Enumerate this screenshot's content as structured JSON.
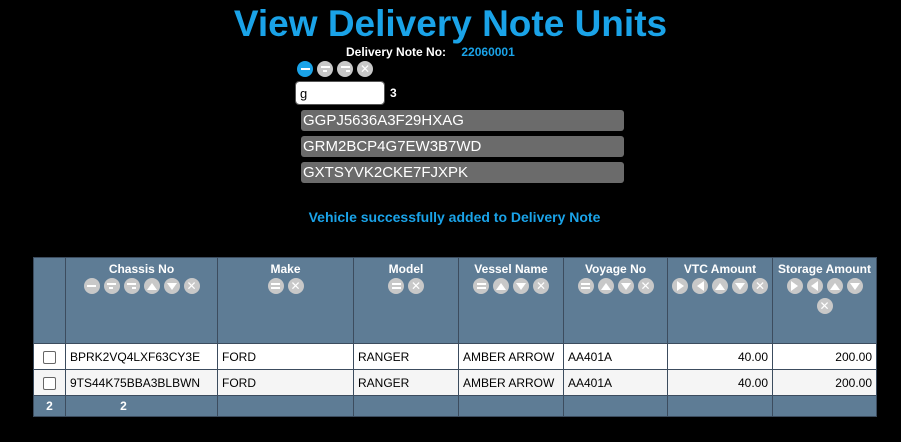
{
  "page": {
    "title": "View Delivery Note Units",
    "delivery_note_label": "Delivery Note No:",
    "delivery_note_value": "22060001",
    "message": "Vehicle successfully added to Delivery Note"
  },
  "filter": {
    "input_value": "g",
    "match_count": "3",
    "suggestions": [
      "GGPJ5636A3F29HXAG",
      "GRM2BCP4G7EW3B7WD",
      "GXTSYVK2CKE7FJXPK"
    ]
  },
  "table": {
    "headers": [
      "Chassis No",
      "Make",
      "Model",
      "Vessel Name",
      "Voyage No",
      "VTC Amount",
      "Storage Amount"
    ],
    "rows": [
      {
        "chassis": "BPRK2VQ4LXF63CY3E",
        "make": "FORD",
        "model": "RANGER",
        "vessel": "AMBER ARROW",
        "voyage": "AA401A",
        "vtc": "40.00",
        "storage": "200.00"
      },
      {
        "chassis": "9TS44K75BBA3BLBWN",
        "make": "FORD",
        "model": "RANGER",
        "vessel": "AMBER ARROW",
        "voyage": "AA401A",
        "vtc": "40.00",
        "storage": "200.00"
      }
    ],
    "footer": {
      "count": "2",
      "chassis_count": "2"
    }
  },
  "colors": {
    "accent": "#1aa3e8",
    "header_bg": "#5e7c95",
    "suggestion_bg": "#6b6b6b"
  },
  "icons": [
    "equals-filter-icon",
    "starts-with-icon",
    "ends-with-icon",
    "clear-filter-icon",
    "sort-asc-icon",
    "sort-desc-icon",
    "greater-than-icon",
    "less-than-icon"
  ]
}
